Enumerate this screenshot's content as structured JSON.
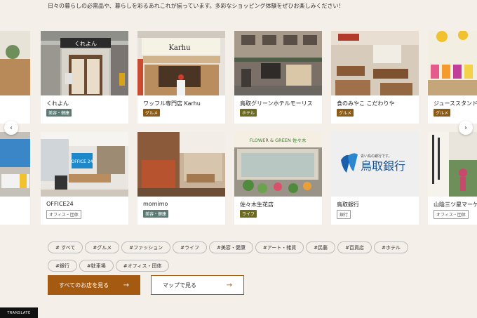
{
  "intro_text": "日々の暮らしの必需品や、暮らしを彩るあれこれが揃っています。多彩なショッピング体験をぜひお楽しみください！",
  "row1": [
    {
      "name": "",
      "tag": ""
    },
    {
      "name": "くれよん",
      "tag": "美容・健康"
    },
    {
      "name": "ワッフル専門店 Karhu",
      "tag": "グルメ"
    },
    {
      "name": "鳥取グリーンホテルモーリス",
      "tag": "ホテル"
    },
    {
      "name": "食のみやこ こだわりや",
      "tag": "グルメ"
    },
    {
      "name": "ジューススタンド&",
      "tag": "グルメ"
    }
  ],
  "row2": [
    {
      "name": "",
      "tag": ""
    },
    {
      "name": "OFFICE24",
      "tag": "オフィス・団体"
    },
    {
      "name": "momimo",
      "tag": "美容・健康"
    },
    {
      "name": "佐々木生花店",
      "tag": "ライフ"
    },
    {
      "name": "鳥取銀行",
      "tag": "銀行"
    },
    {
      "name": "山陰三ツ星マーケッ",
      "tag": "オフィス・団体"
    }
  ],
  "image_text": {
    "kureyon_sign": "くれよん",
    "karhu_sign": "Karhu",
    "office_sign": "OFFICE 24",
    "flower_sign": "FLOWER & GREEN 佐々木",
    "bank_tagline": "青い鳥の銀行です。",
    "bank_name": "鳥取銀行"
  },
  "arrows": {
    "left": "‹",
    "right": "›"
  },
  "hashtags": [
    "# すべて",
    "#グルメ",
    "#ファッション",
    "#ライフ",
    "#美容・健康",
    "#アート・雑貨",
    "#民藝",
    "#百貨店",
    "#ホテル",
    "#銀行",
    "#駐車場",
    "#オフィス・団体"
  ],
  "buttons": {
    "all_stores": "すべてのお店を見る",
    "map": "マップで見る",
    "arrow": "→"
  },
  "translate_label": "TRANSLATE",
  "colors": {
    "accent": "#a55a12",
    "background": "#f5efe9",
    "tag_green": "#5a7a73",
    "tag_brown": "#8b5a14",
    "tag_olive": "#6b6a1f"
  }
}
